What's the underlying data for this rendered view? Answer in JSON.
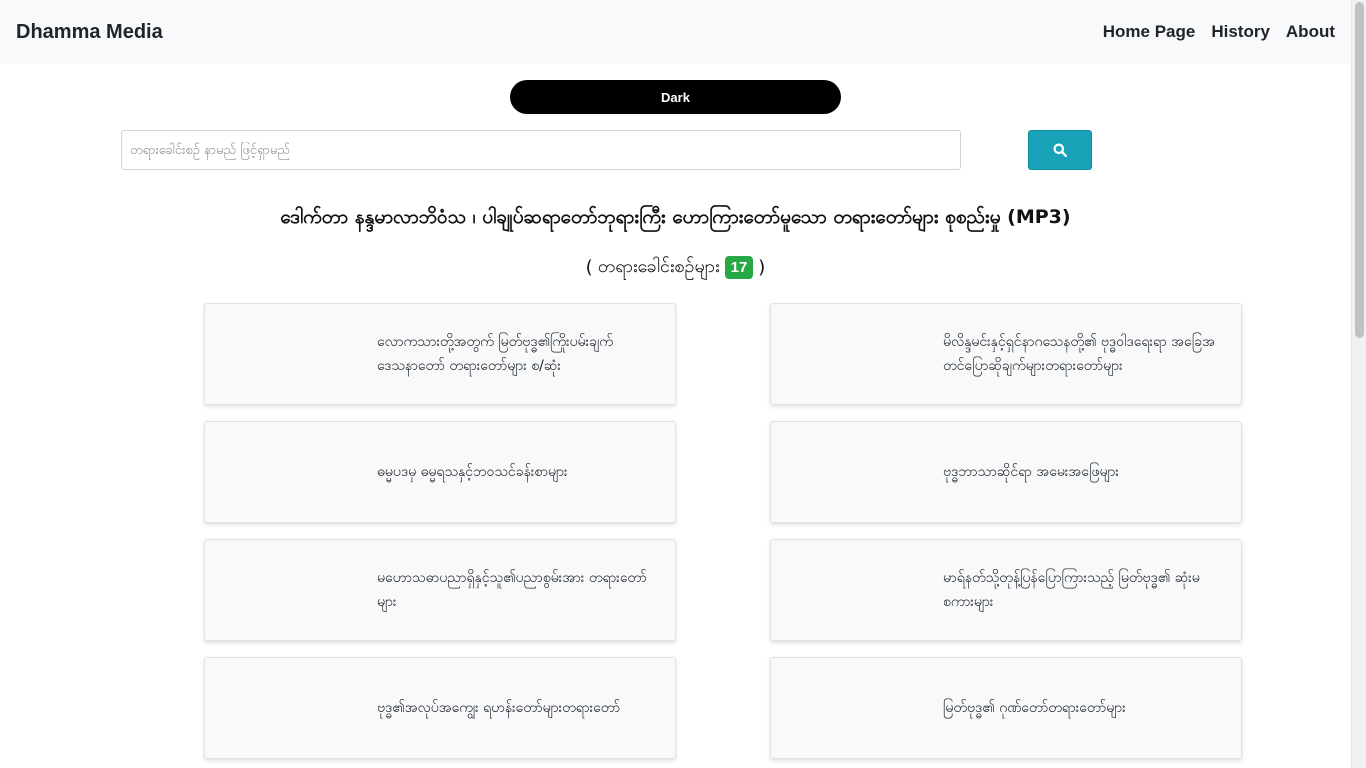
{
  "navbar": {
    "brand": "Dhamma Media",
    "links": [
      "Home Page",
      "History",
      "About"
    ]
  },
  "theme_toggle": {
    "label": "Dark"
  },
  "search": {
    "placeholder": "တရားခေါင်းစဉ် နာမည် ဖြင့်ရှာမည်",
    "button_icon": "search-icon"
  },
  "header": {
    "title": "ဒေါက်တာ နန္ဒမာလာဘိဝံသ ၊ ပါချုပ်ဆရာတော်ဘုရားကြီး ဟောကြားတော်မူသော တရားတော်များ စုစည်းမှု (MP3)",
    "count_open": "(",
    "count_label": "တရားခေါင်းစဉ်များ",
    "count_value": "17",
    "count_close": ")"
  },
  "cards": [
    "လောကသားတို့အတွက် မြတ်ဗုဒ္ဓ၏ကြိုးပမ်းချက် ဒေသနာတော် တရားတော်များ စ/ဆုံး",
    "မိလိန္ဒမင်းနှင့်ရှင်နာဂသေနတို့၏ ဗုဒ္ဓဝါဒရေးရာ အခြေအတင်ပြောဆိုချက်များတရားတော်များ",
    "ဓမ္မပဒမှ ဓမ္မရသနှင့်ဘဝသင်ခန်းစာများ",
    "ဗုဒ္ဓဘာသာဆိုင်ရာ အမေးအဖြေများ",
    "မဟောသဓာပညာရှိနှင့်သူ၏ပညာစွမ်းအား တရားတော်များ",
    "မာရ်နတ်သို့တုန့်ပြန်ပြောကြားသည့် မြတ်ဗုဒ္ဓ၏ ဆုံးမစကားများ",
    "ဗုဒ္ဓ၏အလုပ်အကျွေး ရဟန်းတော်များတရားတော်",
    "မြတ်ဗုဒ္ဓ၏ ဂုဏ်တော်တရားတော်များ"
  ],
  "colors": {
    "accent": "#17a2b8",
    "badge": "#28a745",
    "navbar_bg": "#f8f9fa",
    "dark_button": "#000000"
  }
}
